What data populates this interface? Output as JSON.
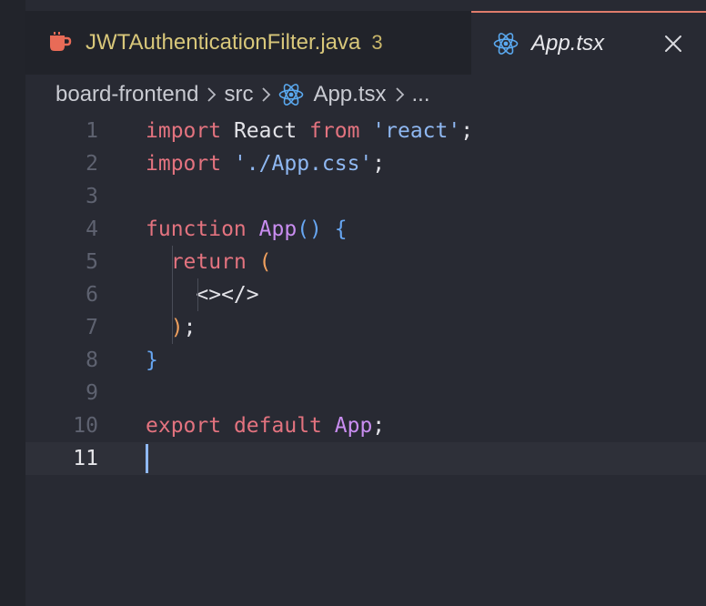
{
  "tabs": [
    {
      "label": "JWTAuthenticationFilter.java",
      "badge": "3",
      "icon": "java-cup-icon",
      "active": false
    },
    {
      "label": "App.tsx",
      "icon": "react-icon",
      "active": true,
      "close_icon": "close-icon"
    }
  ],
  "breadcrumb": {
    "items": [
      "board-frontend",
      "src",
      "App.tsx",
      "..."
    ],
    "icon": "react-icon",
    "separator_icon": "chevron-right-icon"
  },
  "editor": {
    "current_line": 11,
    "line_numbers": [
      "1",
      "2",
      "3",
      "4",
      "5",
      "6",
      "7",
      "8",
      "9",
      "10",
      "11"
    ],
    "lines": {
      "l1": {
        "kw": "import",
        "name": " React ",
        "kw2": "from",
        "sp": " ",
        "str": "'react'",
        "end": ";"
      },
      "l2": {
        "kw": "import",
        "sp": " ",
        "str": "'./App.css'",
        "end": ";"
      },
      "l4": {
        "kw": "function",
        "sp": " ",
        "fn": "App",
        "paren": "()",
        "sp2": " ",
        "brace": "{"
      },
      "l5": {
        "kw": "return",
        "sp": " ",
        "paren": "("
      },
      "l6": {
        "jsx": "<></>"
      },
      "l7": {
        "paren": ")",
        "end": ";"
      },
      "l8": {
        "brace": "}"
      },
      "l10": {
        "kw": "export",
        "sp": " ",
        "kw_b": "default",
        "sp2": " ",
        "fn": "App",
        "end": ";"
      }
    }
  },
  "colors": {
    "keyword": "#e3737f",
    "string": "#8fb8f2",
    "function": "#c98df0",
    "active_tab_border": "#e07c6b",
    "inactive_tab_label": "#d8c77a"
  }
}
